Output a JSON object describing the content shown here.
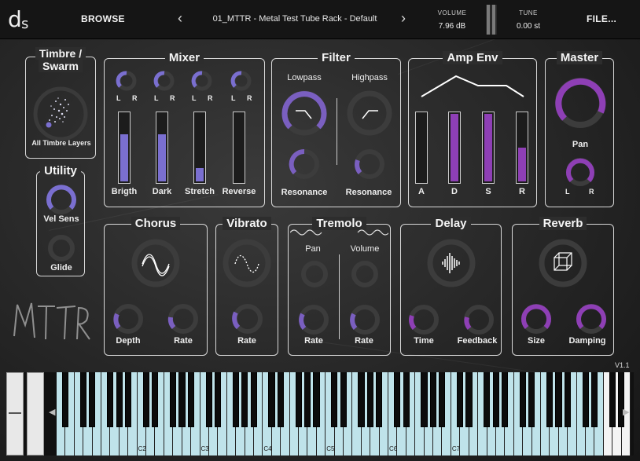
{
  "header": {
    "logo": "ds",
    "browse_label": "BROWSE",
    "preset_name": "01_MTTR - Metal Test Tube Rack - Default",
    "prev_icon": "chevron-left-icon",
    "next_icon": "chevron-right-icon",
    "volume_label": "VOLUME",
    "volume_value": "7.96 dB",
    "tune_label": "TUNE",
    "tune_value": "0.00 st",
    "file_label": "FILE..."
  },
  "timbre": {
    "title_line1": "Timbre /",
    "title_line2": "Swarm",
    "dropdown_label": "All Timbre Layers"
  },
  "utility": {
    "title": "Utility",
    "vel_sens_label": "Vel Sens",
    "glide_label": "Glide"
  },
  "mixer": {
    "title": "Mixer",
    "channels": [
      {
        "label": "Brigth",
        "level": 0.7,
        "lr_l": "L",
        "lr_r": "R"
      },
      {
        "label": "Dark",
        "level": 0.7,
        "lr_l": "L",
        "lr_r": "R"
      },
      {
        "label": "Stretch",
        "level": 0.2,
        "lr_l": "L",
        "lr_r": "R"
      },
      {
        "label": "Reverse",
        "level": 0.0,
        "lr_l": "L",
        "lr_r": "R"
      }
    ]
  },
  "filter": {
    "title": "Filter",
    "lowpass_label": "Lowpass",
    "highpass_label": "Highpass",
    "res1_label": "Resonance",
    "res2_label": "Resonance"
  },
  "amp_env": {
    "title": "Amp Env",
    "bars": [
      {
        "label": "A",
        "level": 0.0
      },
      {
        "label": "D",
        "level": 1.0
      },
      {
        "label": "S",
        "level": 1.0
      },
      {
        "label": "R",
        "level": 0.5
      }
    ]
  },
  "master": {
    "title": "Master",
    "pan_label": "Pan",
    "l": "L",
    "r": "R"
  },
  "chorus": {
    "title": "Chorus",
    "depth_label": "Depth",
    "rate_label": "Rate"
  },
  "vibrato": {
    "title": "Vibrato",
    "rate_label": "Rate"
  },
  "tremolo": {
    "title": "Tremolo",
    "pan_label": "Pan",
    "volume_label": "Volume",
    "rate1_label": "Rate",
    "rate2_label": "Rate"
  },
  "delay": {
    "title": "Delay",
    "time_label": "Time",
    "feedback_label": "Feedback"
  },
  "reverb": {
    "title": "Reverb",
    "size_label": "Size",
    "damping_label": "Damping"
  },
  "keyboard": {
    "version": "V1.1",
    "octave_labels": [
      "C2",
      "C3",
      "C4",
      "C5",
      "C6",
      "C7"
    ]
  },
  "colors": {
    "accent_purple": "#8e3fb5",
    "accent_blue": "#7a6fd0",
    "key_blue": "#bfe3ea"
  },
  "watermark": "MTTR"
}
